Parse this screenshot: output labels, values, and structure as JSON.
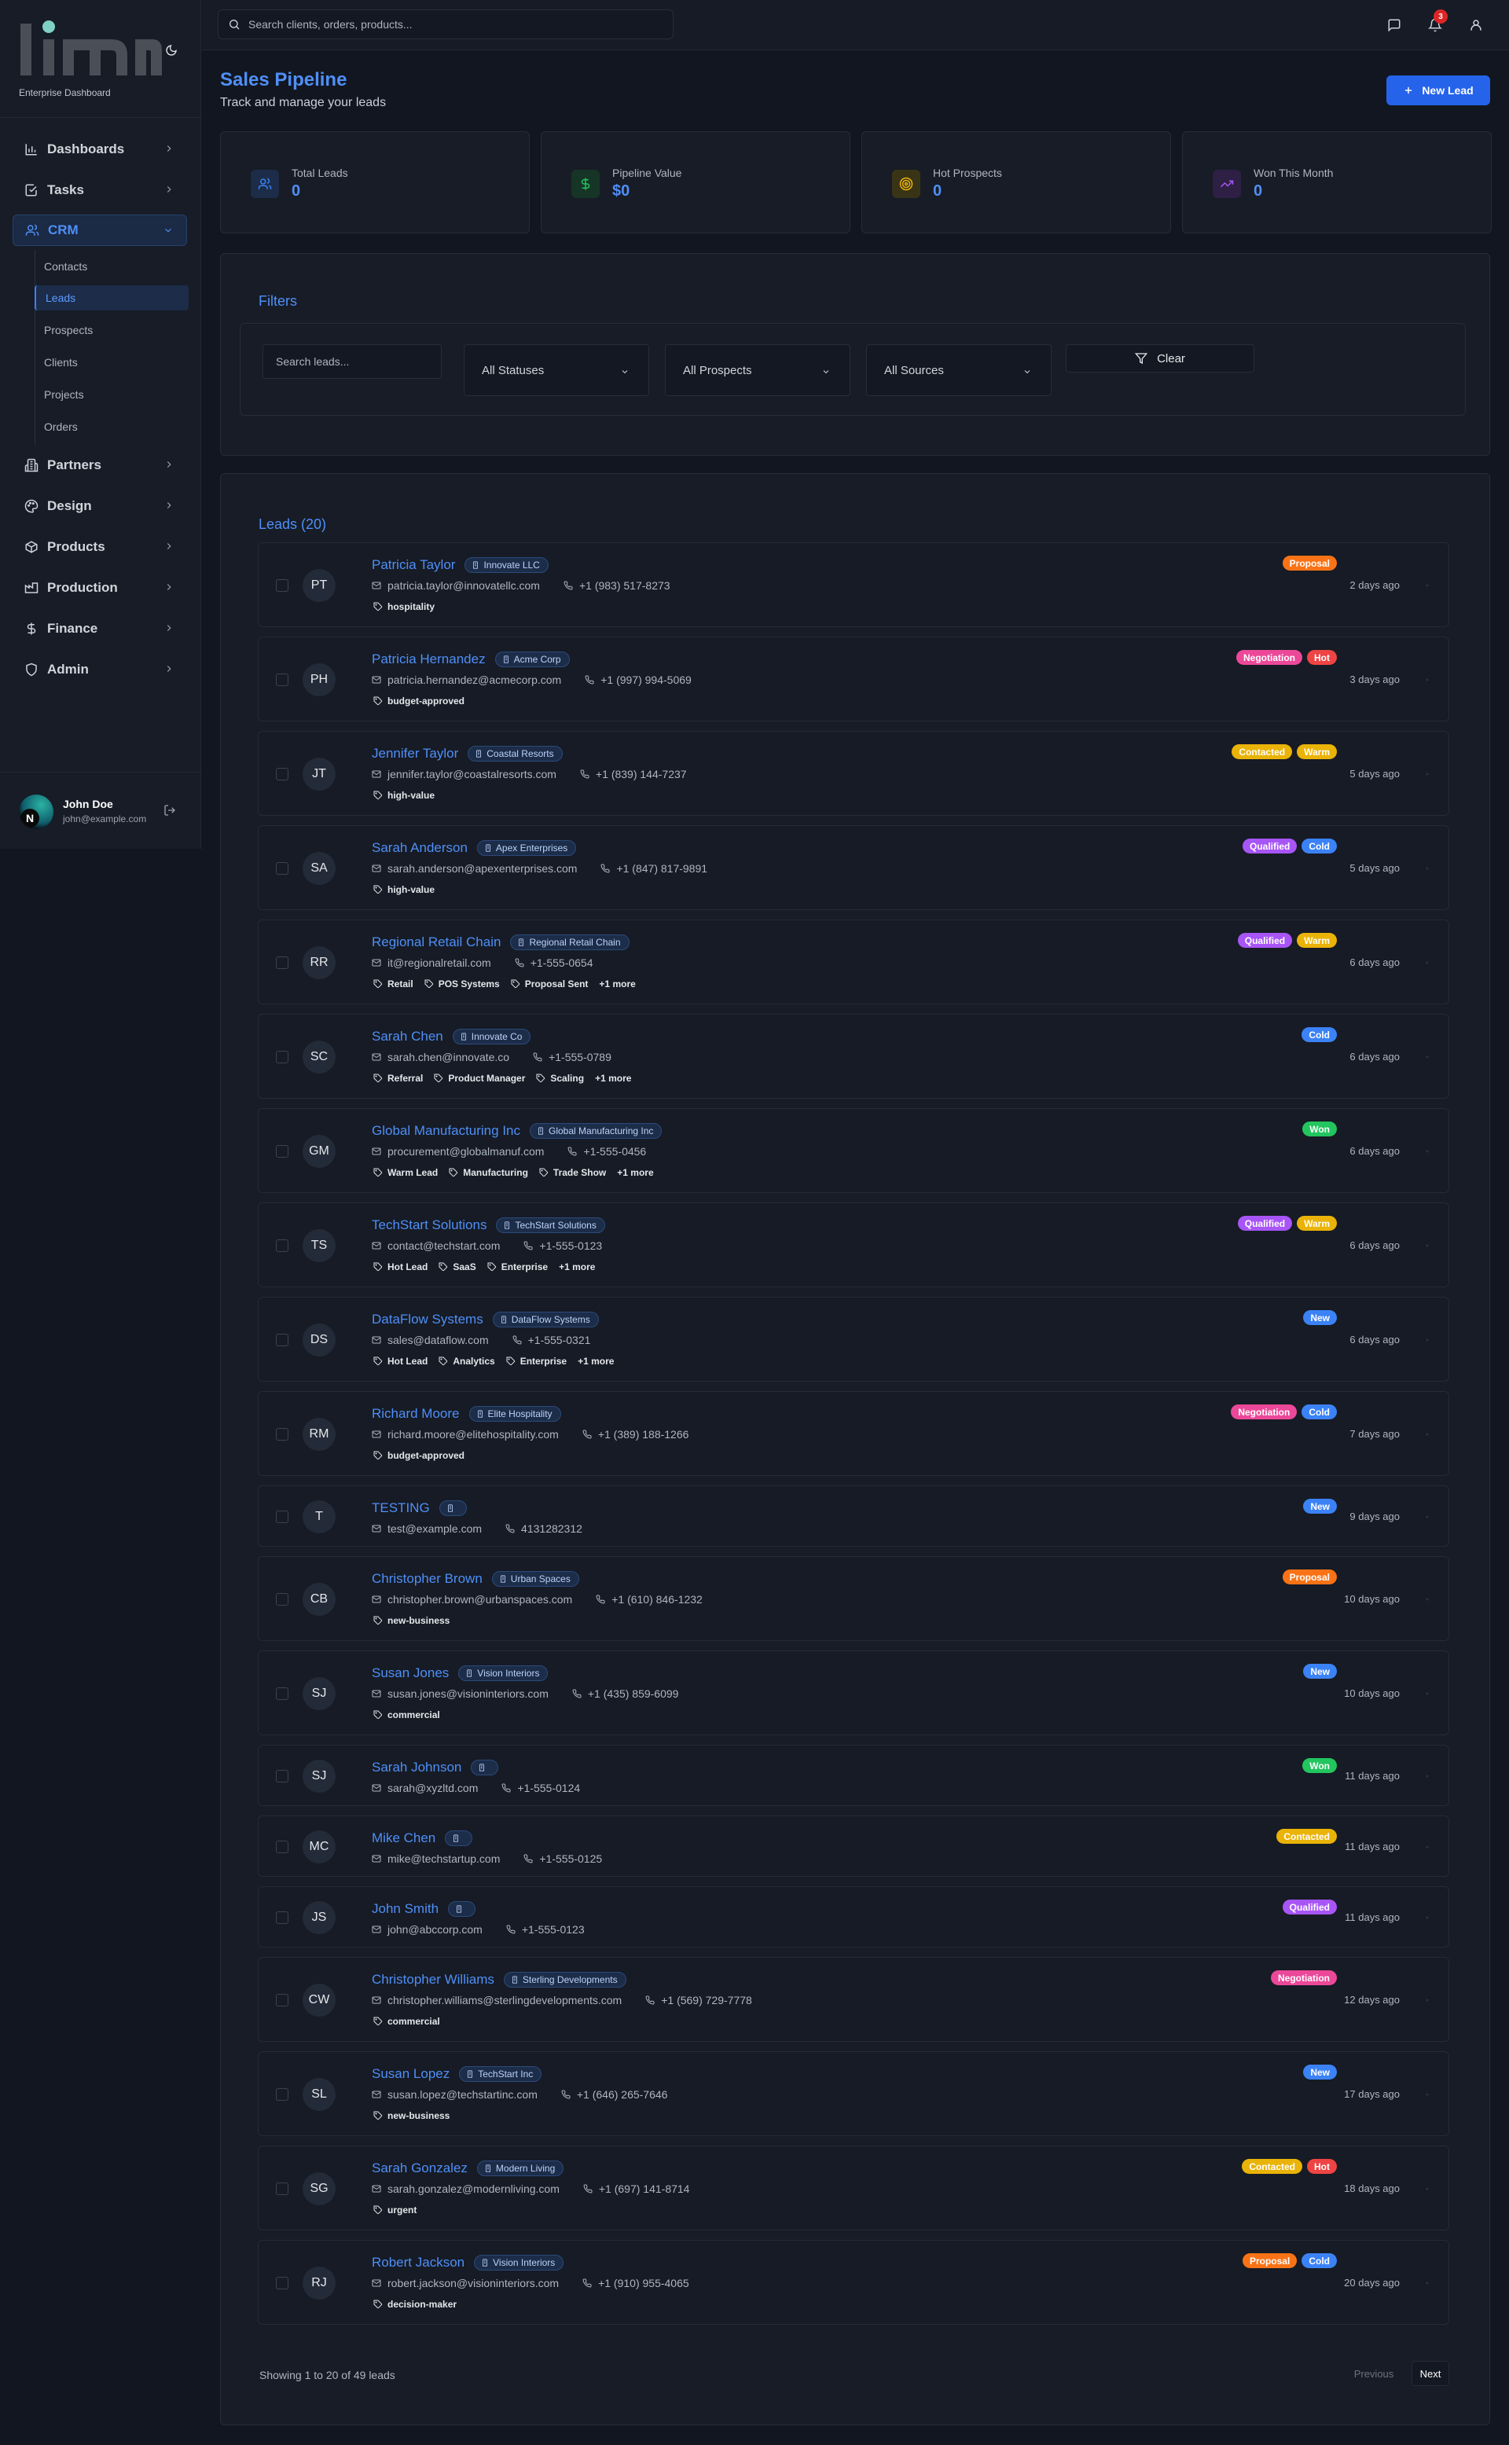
{
  "brand": {
    "logo_text": "linn",
    "subtitle": "Enterprise Dashboard"
  },
  "sidebar": {
    "items": [
      {
        "label": "Dashboards",
        "icon": "bar-chart-icon"
      },
      {
        "label": "Tasks",
        "icon": "check-square-icon"
      },
      {
        "label": "CRM",
        "icon": "users-icon"
      },
      {
        "label": "Partners",
        "icon": "building-icon"
      },
      {
        "label": "Design",
        "icon": "palette-icon"
      },
      {
        "label": "Products",
        "icon": "package-icon"
      },
      {
        "label": "Production",
        "icon": "factory-icon"
      },
      {
        "label": "Finance",
        "icon": "dollar-icon"
      },
      {
        "label": "Admin",
        "icon": "shield-icon"
      }
    ],
    "crm_sub": [
      "Contacts",
      "Leads",
      "Prospects",
      "Clients",
      "Projects",
      "Orders"
    ]
  },
  "user": {
    "name": "John Doe",
    "email": "john@example.com",
    "avatar_initial": "N"
  },
  "header": {
    "search_placeholder": "Search clients, orders, products...",
    "notification_count": "3"
  },
  "page": {
    "title": "Sales Pipeline",
    "subtitle": "Track and manage your leads",
    "new_button": "New Lead"
  },
  "stats": [
    {
      "label": "Total Leads",
      "value": "0",
      "icon": "users-icon",
      "color": "#3b82f6"
    },
    {
      "label": "Pipeline Value",
      "value": "$0",
      "icon": "dollar-icon",
      "color": "#22c55e"
    },
    {
      "label": "Hot Prospects",
      "value": "0",
      "icon": "target-icon",
      "color": "#eab308"
    },
    {
      "label": "Won This Month",
      "value": "0",
      "icon": "trending-up-icon",
      "color": "#a855f7"
    }
  ],
  "filters": {
    "title": "Filters",
    "search_placeholder": "Search leads...",
    "status": "All Statuses",
    "prospect": "All Prospects",
    "source": "All Sources",
    "clear": "Clear"
  },
  "leads_title": "Leads (20)",
  "badge_colors": {
    "Proposal": "#f97316",
    "Negotiation": "#ec4899",
    "Hot": "#ef4444",
    "Contacted": "#eab308",
    "Warm": "#eab308",
    "Qualified": "#a855f7",
    "Cold": "#3b82f6",
    "Won": "#22c55e",
    "New": "#3b82f6"
  },
  "leads": [
    {
      "initials": "PT",
      "name": "Patricia Taylor",
      "company": "Innovate LLC",
      "email": "patricia.taylor@innovatellc.com",
      "phone": "+1 (983) 517-8273",
      "tags": [
        "hospitality"
      ],
      "more": "",
      "badges": [
        "Proposal"
      ],
      "age": "2 days ago"
    },
    {
      "initials": "PH",
      "name": "Patricia Hernandez",
      "company": "Acme Corp",
      "email": "patricia.hernandez@acmecorp.com",
      "phone": "+1 (997) 994-5069",
      "tags": [
        "budget-approved"
      ],
      "more": "",
      "badges": [
        "Negotiation",
        "Hot"
      ],
      "age": "3 days ago"
    },
    {
      "initials": "JT",
      "name": "Jennifer Taylor",
      "company": "Coastal Resorts",
      "email": "jennifer.taylor@coastalresorts.com",
      "phone": "+1 (839) 144-7237",
      "tags": [
        "high-value"
      ],
      "more": "",
      "badges": [
        "Contacted",
        "Warm"
      ],
      "age": "5 days ago"
    },
    {
      "initials": "SA",
      "name": "Sarah Anderson",
      "company": "Apex Enterprises",
      "email": "sarah.anderson@apexenterprises.com",
      "phone": "+1 (847) 817-9891",
      "tags": [
        "high-value"
      ],
      "more": "",
      "badges": [
        "Qualified",
        "Cold"
      ],
      "age": "5 days ago"
    },
    {
      "initials": "RR",
      "name": "Regional Retail Chain",
      "company": "Regional Retail Chain",
      "email": "it@regionalretail.com",
      "phone": "+1-555-0654",
      "tags": [
        "Retail",
        "POS Systems",
        "Proposal Sent"
      ],
      "more": "+1 more",
      "badges": [
        "Qualified",
        "Warm"
      ],
      "age": "6 days ago"
    },
    {
      "initials": "SC",
      "name": "Sarah Chen",
      "company": "Innovate Co",
      "email": "sarah.chen@innovate.co",
      "phone": "+1-555-0789",
      "tags": [
        "Referral",
        "Product Manager",
        "Scaling"
      ],
      "more": "+1 more",
      "badges": [
        "Cold"
      ],
      "age": "6 days ago"
    },
    {
      "initials": "GM",
      "name": "Global Manufacturing Inc",
      "company": "Global Manufacturing Inc",
      "email": "procurement@globalmanuf.com",
      "phone": "+1-555-0456",
      "tags": [
        "Warm Lead",
        "Manufacturing",
        "Trade Show"
      ],
      "more": "+1 more",
      "badges": [
        "Won"
      ],
      "age": "6 days ago"
    },
    {
      "initials": "TS",
      "name": "TechStart Solutions",
      "company": "TechStart Solutions",
      "email": "contact@techstart.com",
      "phone": "+1-555-0123",
      "tags": [
        "Hot Lead",
        "SaaS",
        "Enterprise"
      ],
      "more": "+1 more",
      "badges": [
        "Qualified",
        "Warm"
      ],
      "age": "6 days ago"
    },
    {
      "initials": "DS",
      "name": "DataFlow Systems",
      "company": "DataFlow Systems",
      "email": "sales@dataflow.com",
      "phone": "+1-555-0321",
      "tags": [
        "Hot Lead",
        "Analytics",
        "Enterprise"
      ],
      "more": "+1 more",
      "badges": [
        "New"
      ],
      "age": "6 days ago"
    },
    {
      "initials": "RM",
      "name": "Richard Moore",
      "company": "Elite Hospitality",
      "email": "richard.moore@elitehospitality.com",
      "phone": "+1 (389) 188-1266",
      "tags": [
        "budget-approved"
      ],
      "more": "",
      "badges": [
        "Negotiation",
        "Cold"
      ],
      "age": "7 days ago"
    },
    {
      "initials": "T",
      "name": "TESTING",
      "company": "",
      "email": "test@example.com",
      "phone": "4131282312",
      "tags": [],
      "more": "",
      "badges": [
        "New"
      ],
      "age": "9 days ago"
    },
    {
      "initials": "CB",
      "name": "Christopher Brown",
      "company": "Urban Spaces",
      "email": "christopher.brown@urbanspaces.com",
      "phone": "+1 (610) 846-1232",
      "tags": [
        "new-business"
      ],
      "more": "",
      "badges": [
        "Proposal"
      ],
      "age": "10 days ago"
    },
    {
      "initials": "SJ",
      "name": "Susan Jones",
      "company": "Vision Interiors",
      "email": "susan.jones@visioninteriors.com",
      "phone": "+1 (435) 859-6099",
      "tags": [
        "commercial"
      ],
      "more": "",
      "badges": [
        "New"
      ],
      "age": "10 days ago"
    },
    {
      "initials": "SJ",
      "name": "Sarah Johnson",
      "company": "",
      "email": "sarah@xyzltd.com",
      "phone": "+1-555-0124",
      "tags": [],
      "more": "",
      "badges": [
        "Won"
      ],
      "age": "11 days ago"
    },
    {
      "initials": "MC",
      "name": "Mike Chen",
      "company": "",
      "email": "mike@techstartup.com",
      "phone": "+1-555-0125",
      "tags": [],
      "more": "",
      "badges": [
        "Contacted"
      ],
      "age": "11 days ago"
    },
    {
      "initials": "JS",
      "name": "John Smith",
      "company": "",
      "email": "john@abccorp.com",
      "phone": "+1-555-0123",
      "tags": [],
      "more": "",
      "badges": [
        "Qualified"
      ],
      "age": "11 days ago"
    },
    {
      "initials": "CW",
      "name": "Christopher Williams",
      "company": "Sterling Developments",
      "email": "christopher.williams@sterlingdevelopments.com",
      "phone": "+1 (569) 729-7778",
      "tags": [
        "commercial"
      ],
      "more": "",
      "badges": [
        "Negotiation"
      ],
      "age": "12 days ago"
    },
    {
      "initials": "SL",
      "name": "Susan Lopez",
      "company": "TechStart Inc",
      "email": "susan.lopez@techstartinc.com",
      "phone": "+1 (646) 265-7646",
      "tags": [
        "new-business"
      ],
      "more": "",
      "badges": [
        "New"
      ],
      "age": "17 days ago"
    },
    {
      "initials": "SG",
      "name": "Sarah Gonzalez",
      "company": "Modern Living",
      "email": "sarah.gonzalez@modernliving.com",
      "phone": "+1 (697) 141-8714",
      "tags": [
        "urgent"
      ],
      "more": "",
      "badges": [
        "Contacted",
        "Hot"
      ],
      "age": "18 days ago"
    },
    {
      "initials": "RJ",
      "name": "Robert Jackson",
      "company": "Vision Interiors",
      "email": "robert.jackson@visioninteriors.com",
      "phone": "+1 (910) 955-4065",
      "tags": [
        "decision-maker"
      ],
      "more": "",
      "badges": [
        "Proposal",
        "Cold"
      ],
      "age": "20 days ago"
    }
  ],
  "pagination": {
    "summary": "Showing 1 to 20 of 49 leads",
    "previous": "Previous",
    "next": "Next"
  }
}
